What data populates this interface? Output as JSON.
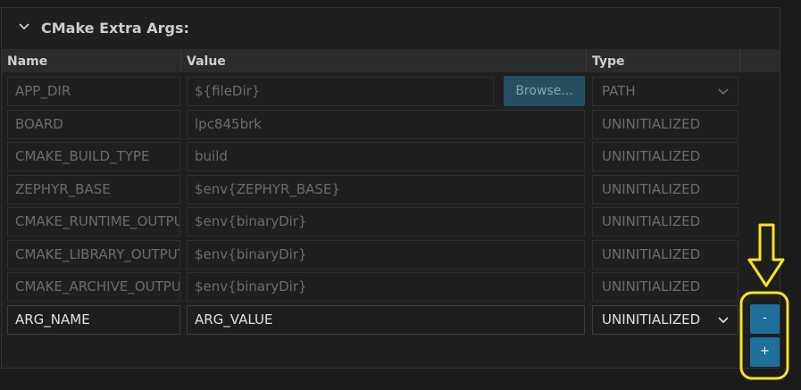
{
  "section": {
    "title": "CMake Extra Args:",
    "toggle_icon": "chevron-down-icon"
  },
  "columns": {
    "name": "Name",
    "value": "Value",
    "type": "Type"
  },
  "rows": [
    {
      "name": "APP_DIR",
      "value": "${fileDir}",
      "type": "PATH",
      "action": "Browse..."
    },
    {
      "name": "BOARD",
      "value": "lpc845brk",
      "type": "UNINITIALIZED"
    },
    {
      "name": "CMAKE_BUILD_TYPE",
      "value": "build",
      "type": "UNINITIALIZED"
    },
    {
      "name": "ZEPHYR_BASE",
      "value": "$env{ZEPHYR_BASE}",
      "type": "UNINITIALIZED"
    },
    {
      "name": "CMAKE_RUNTIME_OUTPUT",
      "value": "$env{binaryDir}",
      "type": "UNINITIALIZED"
    },
    {
      "name": "CMAKE_LIBRARY_OUTPUT",
      "value": "$env{binaryDir}",
      "type": "UNINITIALIZED"
    },
    {
      "name": "CMAKE_ARCHIVE_OUTPUT",
      "value": "$env{binaryDir}",
      "type": "UNINITIALIZED"
    }
  ],
  "new_row": {
    "name": "ARG_NAME",
    "value": "ARG_VALUE",
    "type": "UNINITIALIZED"
  },
  "buttons": {
    "remove": "-",
    "add": "+"
  },
  "annotation": {
    "color": "#f5e61a",
    "icon": "down-arrow-icon"
  }
}
